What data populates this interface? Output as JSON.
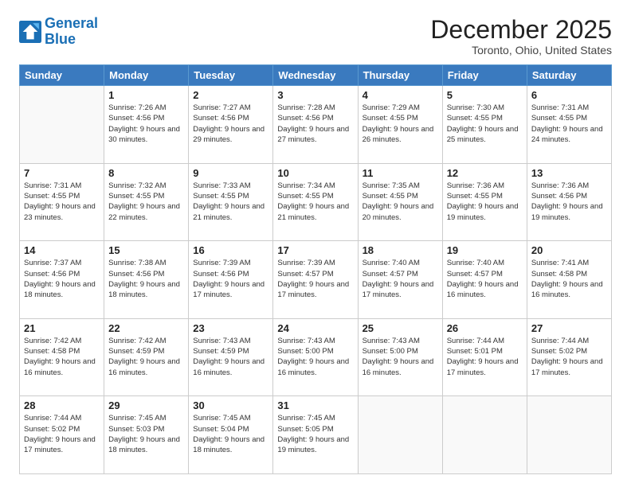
{
  "logo": {
    "line1": "General",
    "line2": "Blue"
  },
  "title": "December 2025",
  "location": "Toronto, Ohio, United States",
  "weekdays": [
    "Sunday",
    "Monday",
    "Tuesday",
    "Wednesday",
    "Thursday",
    "Friday",
    "Saturday"
  ],
  "days": [
    {
      "date": null,
      "sunrise": null,
      "sunset": null,
      "daylight": null
    },
    {
      "date": "1",
      "sunrise": "7:26 AM",
      "sunset": "4:56 PM",
      "daylight": "9 hours and 30 minutes."
    },
    {
      "date": "2",
      "sunrise": "7:27 AM",
      "sunset": "4:56 PM",
      "daylight": "9 hours and 29 minutes."
    },
    {
      "date": "3",
      "sunrise": "7:28 AM",
      "sunset": "4:56 PM",
      "daylight": "9 hours and 27 minutes."
    },
    {
      "date": "4",
      "sunrise": "7:29 AM",
      "sunset": "4:55 PM",
      "daylight": "9 hours and 26 minutes."
    },
    {
      "date": "5",
      "sunrise": "7:30 AM",
      "sunset": "4:55 PM",
      "daylight": "9 hours and 25 minutes."
    },
    {
      "date": "6",
      "sunrise": "7:31 AM",
      "sunset": "4:55 PM",
      "daylight": "9 hours and 24 minutes."
    },
    {
      "date": "7",
      "sunrise": "7:31 AM",
      "sunset": "4:55 PM",
      "daylight": "9 hours and 23 minutes."
    },
    {
      "date": "8",
      "sunrise": "7:32 AM",
      "sunset": "4:55 PM",
      "daylight": "9 hours and 22 minutes."
    },
    {
      "date": "9",
      "sunrise": "7:33 AM",
      "sunset": "4:55 PM",
      "daylight": "9 hours and 21 minutes."
    },
    {
      "date": "10",
      "sunrise": "7:34 AM",
      "sunset": "4:55 PM",
      "daylight": "9 hours and 21 minutes."
    },
    {
      "date": "11",
      "sunrise": "7:35 AM",
      "sunset": "4:55 PM",
      "daylight": "9 hours and 20 minutes."
    },
    {
      "date": "12",
      "sunrise": "7:36 AM",
      "sunset": "4:55 PM",
      "daylight": "9 hours and 19 minutes."
    },
    {
      "date": "13",
      "sunrise": "7:36 AM",
      "sunset": "4:56 PM",
      "daylight": "9 hours and 19 minutes."
    },
    {
      "date": "14",
      "sunrise": "7:37 AM",
      "sunset": "4:56 PM",
      "daylight": "9 hours and 18 minutes."
    },
    {
      "date": "15",
      "sunrise": "7:38 AM",
      "sunset": "4:56 PM",
      "daylight": "9 hours and 18 minutes."
    },
    {
      "date": "16",
      "sunrise": "7:39 AM",
      "sunset": "4:56 PM",
      "daylight": "9 hours and 17 minutes."
    },
    {
      "date": "17",
      "sunrise": "7:39 AM",
      "sunset": "4:57 PM",
      "daylight": "9 hours and 17 minutes."
    },
    {
      "date": "18",
      "sunrise": "7:40 AM",
      "sunset": "4:57 PM",
      "daylight": "9 hours and 17 minutes."
    },
    {
      "date": "19",
      "sunrise": "7:40 AM",
      "sunset": "4:57 PM",
      "daylight": "9 hours and 16 minutes."
    },
    {
      "date": "20",
      "sunrise": "7:41 AM",
      "sunset": "4:58 PM",
      "daylight": "9 hours and 16 minutes."
    },
    {
      "date": "21",
      "sunrise": "7:42 AM",
      "sunset": "4:58 PM",
      "daylight": "9 hours and 16 minutes."
    },
    {
      "date": "22",
      "sunrise": "7:42 AM",
      "sunset": "4:59 PM",
      "daylight": "9 hours and 16 minutes."
    },
    {
      "date": "23",
      "sunrise": "7:43 AM",
      "sunset": "4:59 PM",
      "daylight": "9 hours and 16 minutes."
    },
    {
      "date": "24",
      "sunrise": "7:43 AM",
      "sunset": "5:00 PM",
      "daylight": "9 hours and 16 minutes."
    },
    {
      "date": "25",
      "sunrise": "7:43 AM",
      "sunset": "5:00 PM",
      "daylight": "9 hours and 16 minutes."
    },
    {
      "date": "26",
      "sunrise": "7:44 AM",
      "sunset": "5:01 PM",
      "daylight": "9 hours and 17 minutes."
    },
    {
      "date": "27",
      "sunrise": "7:44 AM",
      "sunset": "5:02 PM",
      "daylight": "9 hours and 17 minutes."
    },
    {
      "date": "28",
      "sunrise": "7:44 AM",
      "sunset": "5:02 PM",
      "daylight": "9 hours and 17 minutes."
    },
    {
      "date": "29",
      "sunrise": "7:45 AM",
      "sunset": "5:03 PM",
      "daylight": "9 hours and 18 minutes."
    },
    {
      "date": "30",
      "sunrise": "7:45 AM",
      "sunset": "5:04 PM",
      "daylight": "9 hours and 18 minutes."
    },
    {
      "date": "31",
      "sunrise": "7:45 AM",
      "sunset": "5:05 PM",
      "daylight": "9 hours and 19 minutes."
    }
  ],
  "labels": {
    "sunrise": "Sunrise:",
    "sunset": "Sunset:",
    "daylight": "Daylight:"
  }
}
